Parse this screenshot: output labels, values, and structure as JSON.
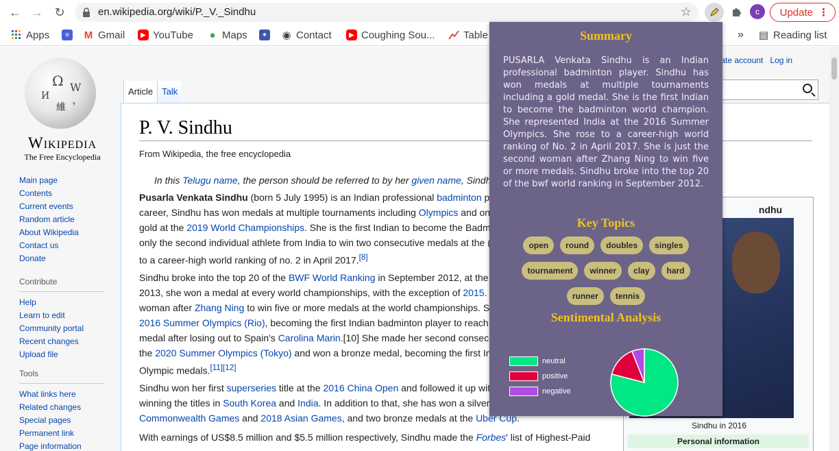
{
  "browser": {
    "url": "en.wikipedia.org/wiki/P._V._Sindhu",
    "update_label": "Update",
    "profile_initial": "c",
    "reading_list": "Reading list",
    "more_chevron": "»"
  },
  "bookmarks": [
    {
      "label": "Apps",
      "icon": "apps-grid-icon"
    },
    {
      "label": "",
      "icon": "docs-icon"
    },
    {
      "label": "Gmail",
      "icon": "gmail-icon"
    },
    {
      "label": "YouTube",
      "icon": "youtube-icon"
    },
    {
      "label": "Maps",
      "icon": "maps-icon"
    },
    {
      "label": "",
      "icon": "bookmark-thumb-icon"
    },
    {
      "label": "Contact",
      "icon": "globe-icon"
    },
    {
      "label": "Coughing Sou...",
      "icon": "youtube-icon"
    },
    {
      "label": "Table",
      "icon": "chart-icon"
    }
  ],
  "wiki": {
    "wordmark": "Wikipedia",
    "tagline": "The Free Encyclopedia",
    "nav_main": [
      "Main page",
      "Contents",
      "Current events",
      "Random article",
      "About Wikipedia",
      "Contact us",
      "Donate"
    ],
    "contribute_heading": "Contribute",
    "nav_contribute": [
      "Help",
      "Learn to edit",
      "Community portal",
      "Recent changes",
      "Upload file"
    ],
    "tools_heading": "Tools",
    "nav_tools": [
      "What links here",
      "Related changes",
      "Special pages",
      "Permanent link",
      "Page information"
    ],
    "tabs": [
      "Article",
      "Talk"
    ],
    "user_links_partial": "s",
    "create_account": "Create account",
    "log_in": "Log in",
    "title": "P. V. Sindhu",
    "from": "From Wikipedia, the free encyclopedia",
    "hatnote": {
      "t1": "In this ",
      "l1": "Telugu name",
      "t2": ", the person should be referred to by her ",
      "l2": "given name",
      "t3": ", Sindh"
    },
    "p1": [
      {
        "b": "Pusarla Venkata Sindhu",
        "t": " (born 5 July 1995) is an Indian professional ",
        "l": "badminton",
        "e": " p"
      },
      {
        "t": "career, Sindhu has won medals at multiple tournaments including ",
        "l": "Olympics",
        "e": " and on"
      },
      {
        "t": "gold at the ",
        "l": "2019 World Championships",
        "e": ". She is the first Indian to become the Badm"
      },
      {
        "t": "only the second individual athlete from India to win two consecutive medals at the ",
        "l": "",
        "e": "("
      },
      {
        "t": "to a career-high world ranking of no. 2 in April 2017.",
        "l": "[8]",
        "e": ""
      }
    ],
    "p2": [
      {
        "t": "Sindhu broke into the top 20 of the ",
        "l": "BWF World Ranking",
        "e": " in September 2012, at the"
      },
      {
        "t": "2013, she won a medal at every world championships, with the exception of ",
        "l": "2015",
        "e": "."
      },
      {
        "t": "woman after ",
        "l": "Zhang Ning",
        "e": " to win five or more medals at the world championships. S"
      },
      {
        "t": "",
        "l": "2016 Summer Olympics (Rio)",
        "e": ", becoming the first Indian badminton player to reach"
      },
      {
        "t": "medal after losing out to Spain's ",
        "l": "Carolina Marin",
        "e": ".[10] She made her second consecu"
      },
      {
        "t": "the ",
        "l": "2020 Summer Olympics (Tokyo)",
        "e": " and won a bronze medal, becoming the first In"
      },
      {
        "t": "Olympic medals.",
        "l": "[11][12]",
        "e": ""
      }
    ],
    "p3": [
      {
        "t": "Sindhu won her first ",
        "l": "superseries",
        "e": " title at the "
      },
      {
        "t": "winning the titles in ",
        "l": "South Korea",
        "e": " and "
      },
      {
        "t": "",
        "l": "Commonwealth Games",
        "e": " and "
      }
    ],
    "p3_extra": {
      "l1b": "2016 China Open",
      "e1b": " and followed it up wit",
      "l2b": "India",
      "e2b": ". In addition to that, she has won a silver",
      "l3b": "2018 Asian Games",
      "e3b": ", and two bronze medals at the ",
      "l3c": "Uber Cup",
      "e3c": "."
    },
    "p4": {
      "t": "With earnings of US$8.5 million and $5.5 million respectively, Sindhu made the ",
      "l": "Forbes",
      "e": "' list of Highest-Paid"
    },
    "infobox_name_partial": "ndhu",
    "infobox_caption": "Sindhu in 2016",
    "infobox_section": "Personal information"
  },
  "popup": {
    "summary_heading": "Summary",
    "summary_text": "PUSARLA Venkata Sindhu is an Indian professional badminton player. Sindhu has won medals at multiple tournaments including a gold medal. She is the first Indian to become the badminton world champion. She represented India at the 2016 Summer Olympics. She rose to a career-high world ranking of No. 2 in April 2017. She is just the second woman after Zhang Ning to win five or more medals. Sindhu broke into the top 20 of the bwf world ranking in September 2012.",
    "topics_heading": "Key Topics",
    "topics": [
      [
        "open",
        "round",
        "doubles",
        "singles"
      ],
      [
        "tournament",
        "winner",
        "clay",
        "hard"
      ],
      [
        "runner",
        "tennis"
      ]
    ],
    "sentiment_heading": "Sentimental Analysis"
  },
  "chart_data": {
    "type": "pie",
    "categories": [
      "neutral",
      "positive",
      "negative"
    ],
    "values": [
      0.79,
      0.15,
      0.06
    ],
    "colors": [
      "#00e884",
      "#e0003c",
      "#b14be6"
    ],
    "title": "",
    "legend": "left"
  }
}
